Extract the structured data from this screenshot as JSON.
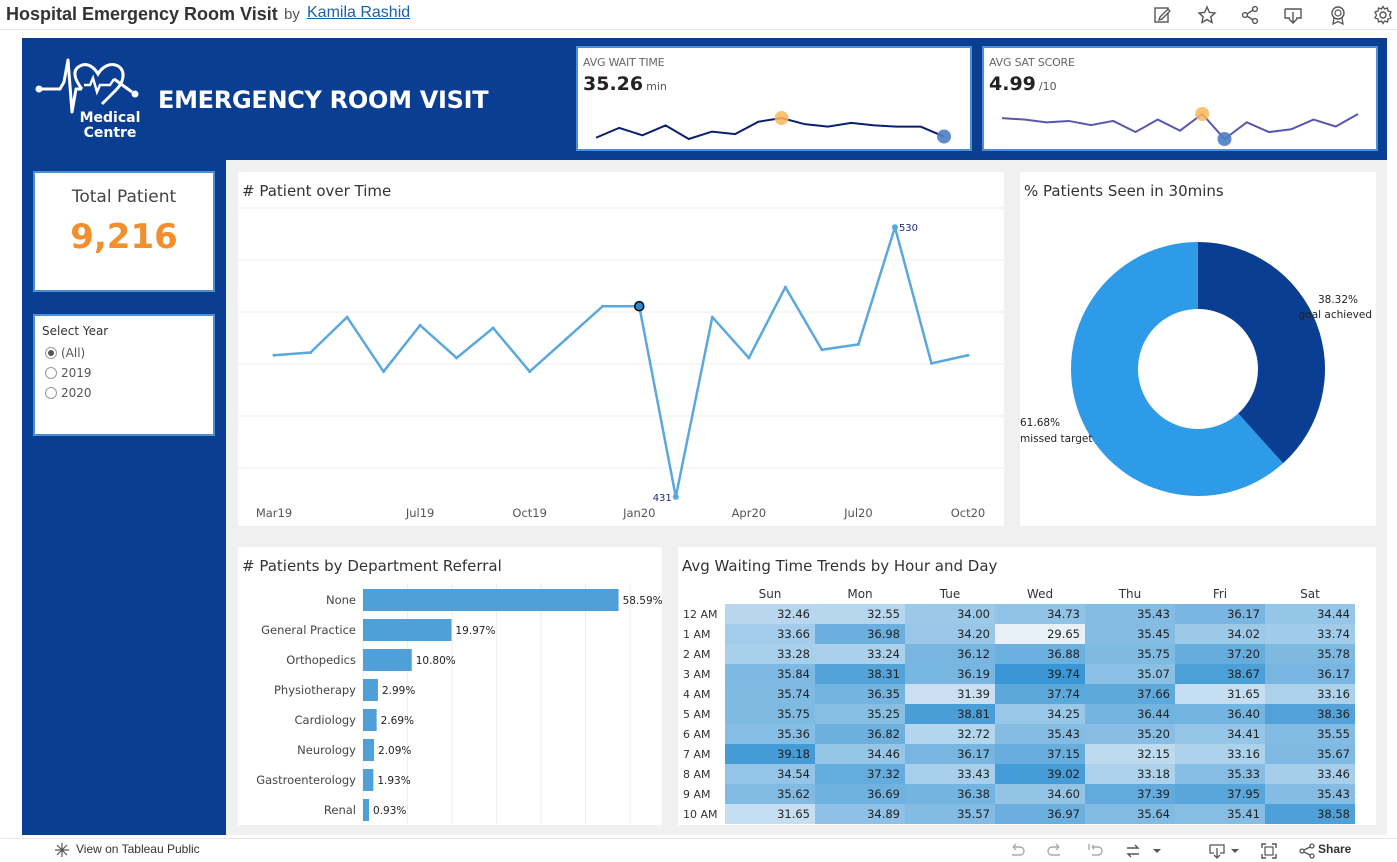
{
  "top_bar": {
    "title": "Hospital Emergency Room Visit",
    "by": "by",
    "author": "Kamila Rashid",
    "icons": [
      "edit-icon",
      "star-icon",
      "share-icon",
      "download-icon",
      "badge-icon",
      "settings-icon"
    ]
  },
  "header": {
    "logo_line1": "Medical",
    "logo_line2": "Centre",
    "title": "EMERGENCY ROOM VISIT"
  },
  "kpi_wait": {
    "label": "AVG WAIT TIME",
    "value": "35.26",
    "unit": "min",
    "spark": [
      34.6,
      35.4,
      34.8,
      35.6,
      34.5,
      35.1,
      34.9,
      35.9,
      36.2,
      35.7,
      35.5,
      35.8,
      35.6,
      35.5,
      35.5,
      34.7
    ],
    "highlight_high_index": 8,
    "highlight_low_index": 15
  },
  "kpi_sat": {
    "label": "AVG SAT SCORE",
    "value": "4.99",
    "unit": "/10",
    "spark": [
      5.03,
      5.02,
      5.0,
      5.01,
      4.98,
      5.01,
      4.93,
      5.02,
      4.94,
      5.06,
      4.88,
      5.0,
      4.93,
      4.95,
      5.02,
      4.97,
      5.06
    ],
    "highlight_high_index": 9,
    "highlight_low_index": 10
  },
  "total_patient": {
    "label": "Total Patient",
    "value": "9,216"
  },
  "select_year": {
    "title": "Select Year",
    "options": [
      {
        "label": "(All)",
        "selected": true
      },
      {
        "label": "2019",
        "selected": false
      },
      {
        "label": "2020",
        "selected": false
      }
    ]
  },
  "chart_data": [
    {
      "type": "line",
      "title": "# Patient over Time",
      "x": [
        "Mar19",
        "Apr19",
        "May19",
        "Jun19",
        "Jul19",
        "Aug19",
        "Sep19",
        "Oct19",
        "Nov19",
        "Dec19",
        "Jan20",
        "Feb20",
        "Mar20",
        "Apr20",
        "May20",
        "Jun20",
        "Jul20",
        "Aug20",
        "Sep20",
        "Oct20"
      ],
      "tick_labels": [
        "Mar19",
        "Jul19",
        "Oct19",
        "Jan20",
        "Apr20",
        "Jul20",
        "Oct20"
      ],
      "values": [
        483,
        484,
        497,
        477,
        494,
        482,
        493,
        477,
        489,
        501,
        501,
        431,
        497,
        482,
        508,
        485,
        487,
        530,
        480,
        483
      ],
      "annotations": [
        {
          "index": 17,
          "label": "530"
        },
        {
          "index": 11,
          "label": "431"
        }
      ],
      "highlight_index": 10,
      "ylim": [
        428,
        540
      ],
      "grid": "horizontal",
      "color": "#5aa8de"
    },
    {
      "type": "pie",
      "title": "% Patients Seen in 30mins",
      "slices": [
        {
          "label": "goal achieved",
          "value": 38.32,
          "pct_label": "38.32%",
          "color": "#0a3e93"
        },
        {
          "label": "missed target",
          "value": 61.68,
          "pct_label": "61.68%",
          "color": "#2d9be8"
        }
      ]
    },
    {
      "type": "bar",
      "title": "# Patients by Department Referral",
      "categories": [
        "None",
        "General Practice",
        "Orthopedics",
        "Physiotherapy",
        "Cardiology",
        "Neurology",
        "Gastroenterology",
        "Renal"
      ],
      "values": [
        58.59,
        19.97,
        10.8,
        2.99,
        2.69,
        2.09,
        1.93,
        0.93
      ],
      "value_labels": [
        "58.59%",
        "19.97%",
        "10.80%",
        "2.99%",
        "2.69%",
        "2.09%",
        "1.93%",
        "0.93%"
      ],
      "orientation": "horizontal",
      "color": "#4f9fd9"
    },
    {
      "type": "heatmap",
      "title": "Avg Waiting Time Trends by Hour and Day",
      "columns": [
        "Sun",
        "Mon",
        "Tue",
        "Wed",
        "Thu",
        "Fri",
        "Sat"
      ],
      "rows": [
        "12 AM",
        "1 AM",
        "2 AM",
        "3 AM",
        "4 AM",
        "5 AM",
        "6 AM",
        "7 AM",
        "8 AM",
        "9 AM",
        "10 AM"
      ],
      "values": [
        [
          "32.46",
          "32.55",
          "34.00",
          "34.73",
          "35.43",
          "36.17",
          "34.44"
        ],
        [
          "33.66",
          "36.98",
          "34.20",
          "29.65",
          "35.45",
          "34.02",
          "33.74"
        ],
        [
          "33.28",
          "33.24",
          "36.12",
          "36.88",
          "35.75",
          "37.20",
          "35.78"
        ],
        [
          "35.84",
          "38.31",
          "36.19",
          "39.74",
          "35.07",
          "38.67",
          "36.17"
        ],
        [
          "35.74",
          "36.35",
          "31.39",
          "37.74",
          "37.66",
          "31.65",
          "33.16"
        ],
        [
          "35.75",
          "35.25",
          "38.81",
          "34.25",
          "36.44",
          "36.40",
          "38.36"
        ],
        [
          "35.36",
          "36.82",
          "32.72",
          "35.43",
          "35.20",
          "34.41",
          "35.55"
        ],
        [
          "39.18",
          "34.46",
          "36.17",
          "37.15",
          "32.15",
          "33.16",
          "35.67"
        ],
        [
          "34.54",
          "37.32",
          "33.43",
          "39.02",
          "33.18",
          "35.33",
          "33.46"
        ],
        [
          "35.62",
          "36.69",
          "36.38",
          "34.60",
          "37.39",
          "37.95",
          "35.43"
        ],
        [
          "31.65",
          "34.89",
          "35.57",
          "36.97",
          "35.64",
          "35.41",
          "38.58"
        ]
      ],
      "color_min": 29.65,
      "color_max": 39.74
    }
  ],
  "bottom_bar": {
    "view_label": "View on Tableau Public",
    "share_label": "Share"
  }
}
